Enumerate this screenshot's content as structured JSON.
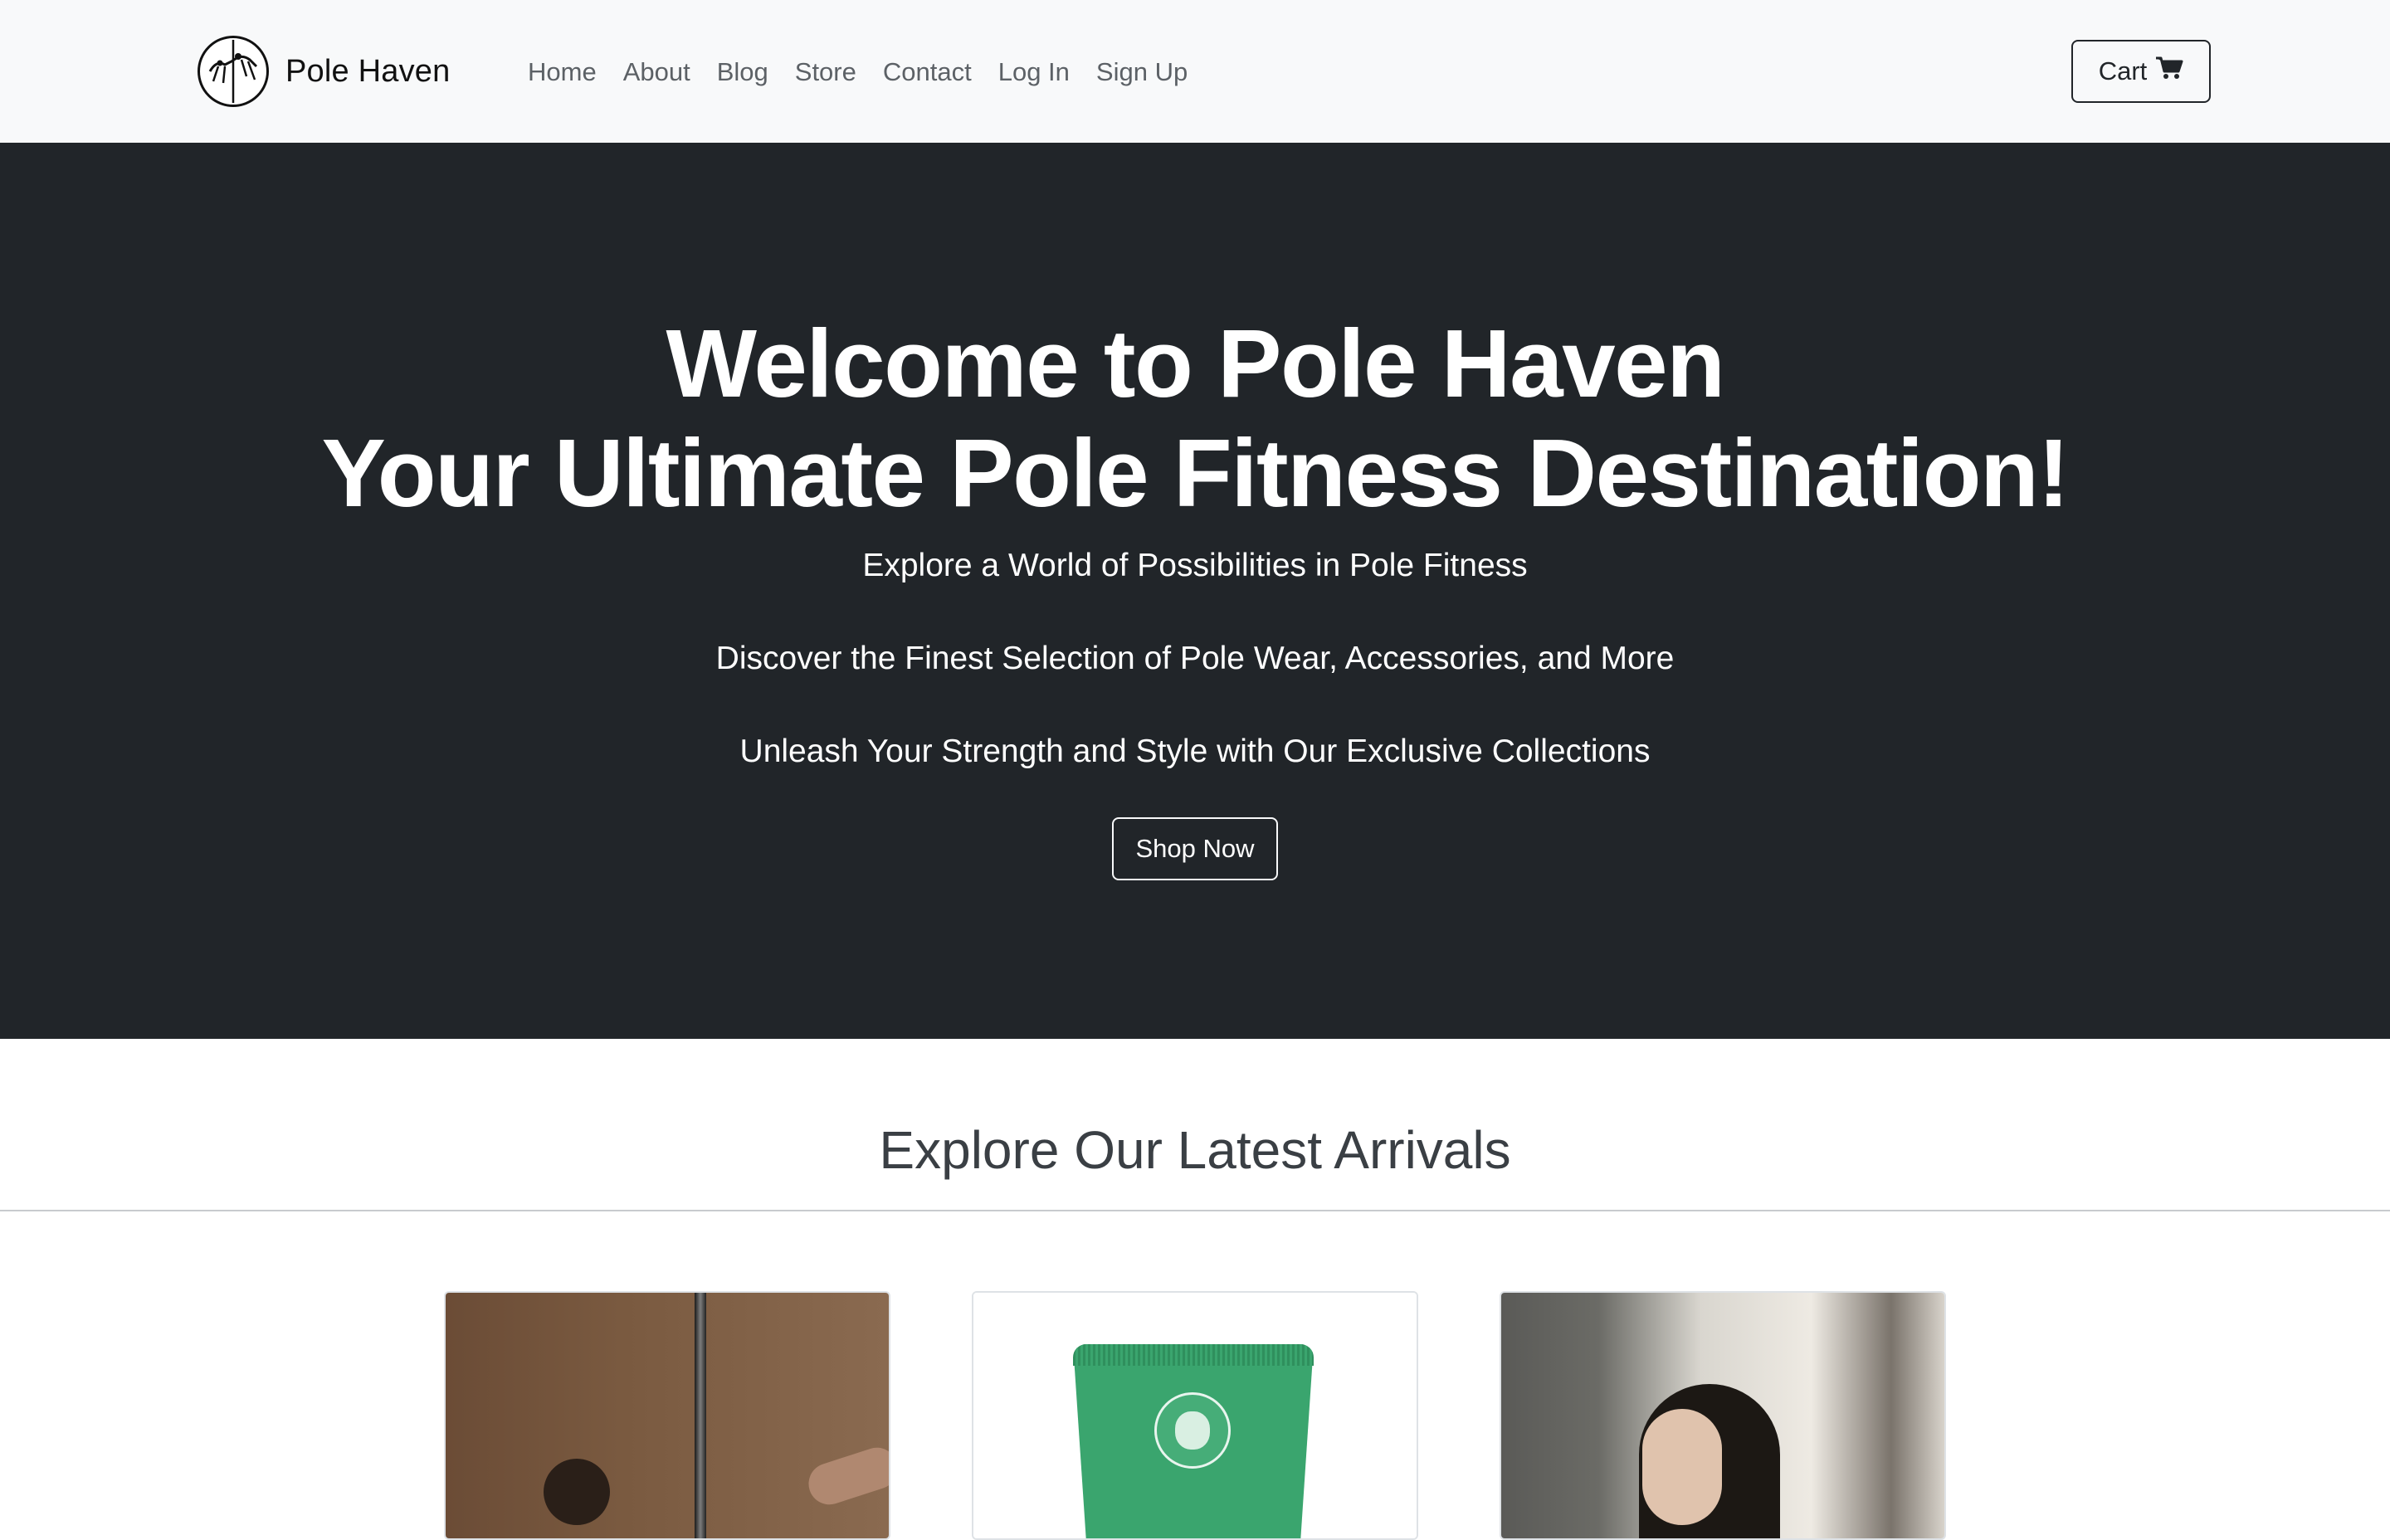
{
  "navbar": {
    "brand_name": "Pole Haven",
    "brand_logo": "pole-dancer-logo",
    "links": [
      "Home",
      "About",
      "Blog",
      "Store",
      "Contact",
      "Log In",
      "Sign Up"
    ],
    "cart_label": "Cart",
    "cart_icon": "shopping-cart-icon"
  },
  "hero": {
    "title_line1": "Welcome to Pole Haven",
    "title_line2": "Your Ultimate Pole Fitness Destination!",
    "subtitle1": "Explore a World of Possibilities in Pole Fitness",
    "subtitle2": "Discover the Finest Selection of Pole Wear, Accessories, and More",
    "subtitle3": "Unleash Your Strength and Style with Our Exclusive Collections",
    "cta_label": "Shop Now",
    "background_color": "#212529"
  },
  "arrivals": {
    "title": "Explore Our Latest Arrivals",
    "cards": [
      {
        "image": "pole-dancer-photo"
      },
      {
        "image": "green-grip-tube-photo"
      },
      {
        "image": "woman-portrait-photo"
      }
    ]
  }
}
